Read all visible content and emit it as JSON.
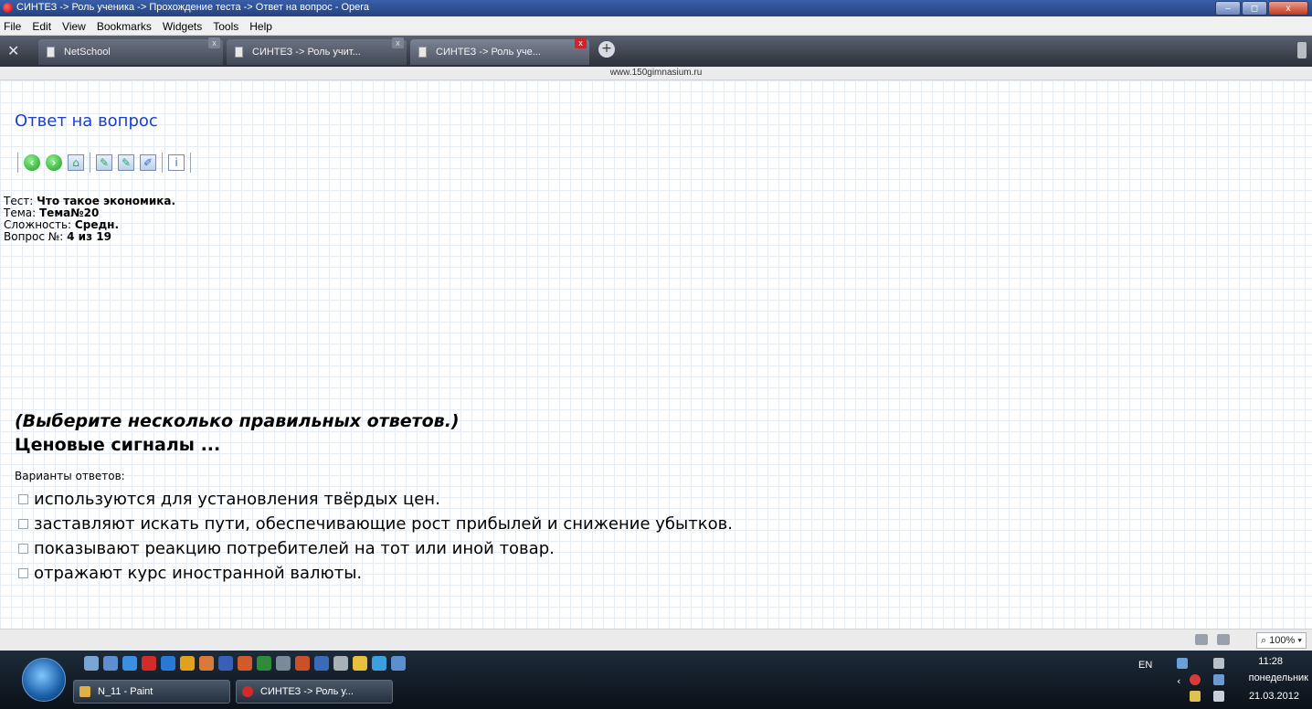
{
  "window": {
    "title": "СИНТЕЗ -> Роль ученика -> Прохождение теста -> Ответ на вопрос - Opera",
    "minimize": "–",
    "maximize": "◻",
    "close": "x"
  },
  "menu": [
    "File",
    "Edit",
    "View",
    "Bookmarks",
    "Widgets",
    "Tools",
    "Help"
  ],
  "tabs": [
    {
      "label": "NetSchool",
      "close": "x"
    },
    {
      "label": "СИНТЕЗ -> Роль учит...",
      "close": "x"
    },
    {
      "label": "СИНТЕЗ -> Роль уче...",
      "close": "x"
    }
  ],
  "new_tab": "+",
  "address": "www.150gimnasium.ru",
  "page": {
    "title": "Ответ на вопрос",
    "toolbar_icons": [
      "back-icon",
      "forward-icon",
      "home-icon",
      "mark-icon",
      "mark-next-icon",
      "pen-icon",
      "info-icon"
    ],
    "test_label": "Тест:",
    "test_value": "Что такое экономика.",
    "topic_label": "Тема:",
    "topic_value": "Тема№20",
    "difficulty_label": "Сложность:",
    "difficulty_value": "Средн.",
    "question_no_label": "Вопрос №:",
    "question_no_value": "4 из 19",
    "hint": "(Выберите несколько правильных ответов.)",
    "question": "Ценовые сигналы ...",
    "variants_label": "Варианты ответов:",
    "options": [
      "используются для установления твёрдых цен.",
      "заставляют искать пути, обеспечивающие рост прибылей и снижение убытков.",
      "показывают реакцию потребителей на тот или иной товар.",
      "отражают курс иностранной валюты."
    ]
  },
  "statusbar": {
    "zoom": "100%"
  },
  "taskbar": {
    "tasks": [
      {
        "label": "N_11 - Paint"
      },
      {
        "label": "СИНТЕЗ -> Роль у..."
      }
    ],
    "lang": "EN",
    "time": "11:28",
    "day": "понедельник",
    "date": "21.03.2012"
  }
}
